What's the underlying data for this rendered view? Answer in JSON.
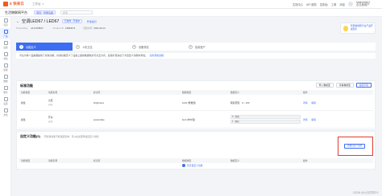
{
  "header": {
    "brand": "E 快来云",
    "console": "工作台",
    "nav": [
      "文档中心",
      "API 服务",
      "控制台",
      "工单",
      "消息"
    ],
    "user_line1": "MatrixMe01",
    "user_line2": "企业版用户"
  },
  "subbar": {
    "title": "生活物联网平台",
    "badge": "项目：智能设备",
    "search_placeholder": "搜索"
  },
  "sidebar": {
    "items": [
      {
        "label": "首页",
        "active": false
      },
      {
        "label": "产品",
        "active": true
      },
      {
        "label": "设备",
        "active": false
      },
      {
        "label": "调试",
        "active": false
      },
      {
        "label": "运维",
        "active": false
      },
      {
        "label": "数据",
        "active": false
      },
      {
        "label": "服务",
        "active": false
      },
      {
        "label": "设置",
        "active": false
      },
      {
        "label": "文档",
        "active": false
      }
    ]
  },
  "product": {
    "name": "空调LED67 / LED67",
    "tag": "已发布 · 开发中",
    "share": "开发指引",
    "meta": [
      {
        "key": "ProductKey",
        "value": "a1xT2b8MV"
      },
      {
        "key": "Product ID",
        "value": "13684072"
      },
      {
        "key": "创建时间",
        "value": "2021-09-12"
      }
    ],
    "help": "阿里物联网平台产品开发指引"
  },
  "steps": [
    {
      "num": "1",
      "label": "功能定义"
    },
    {
      "num": "2",
      "label": "人机交互"
    },
    {
      "num": "3",
      "label": "设备调试"
    },
    {
      "num": "4",
      "label": "批量投产"
    }
  ],
  "notice": {
    "text": "平台为每个品类都提供了标准功能，标准功能定义了设备上报的数据格式与交互方式，如需扩展请在下方自定义功能中添加。",
    "link": "如何添加功能"
  },
  "standard": {
    "title": "标准功能",
    "buttons": {
      "import": "导入物模型",
      "history": "查看物模型",
      "edit": "编辑草稿"
    },
    "columns": [
      "功能类型",
      "功能名称",
      "标识符",
      "数据类型",
      "数据定义",
      "操作"
    ],
    "rows": [
      {
        "type": "属性",
        "name": "亮度",
        "name_sub": "必选",
        "identifier": "brightness",
        "dtype": "int32 (整数型)",
        "ddef": "取值范围：0 ~ 100",
        "ops": [
          "详情",
          "编辑"
        ]
      },
      {
        "type": "属性",
        "name": "开关",
        "name_sub": "必选",
        "identifier": "powerstate",
        "dtype": "bool (布尔型)",
        "ddef1": "0 - 关闭",
        "ddef2": "1 - 开启",
        "ops": [
          "详情",
          "编辑"
        ]
      }
    ]
  },
  "custom": {
    "title": "自定义功能",
    "count": "(0)",
    "hint": "若标准功能不能满足需求，可以在这里添加自定义功能。",
    "columns": [
      "功能类型",
      "功能名称",
      "标识符",
      "数据类型",
      "数据定义",
      "操作"
    ],
    "empty": "暂无自定义功能",
    "add_button": "添加自定义功能"
  },
  "watermark": "CSDN @小白同学DY"
}
